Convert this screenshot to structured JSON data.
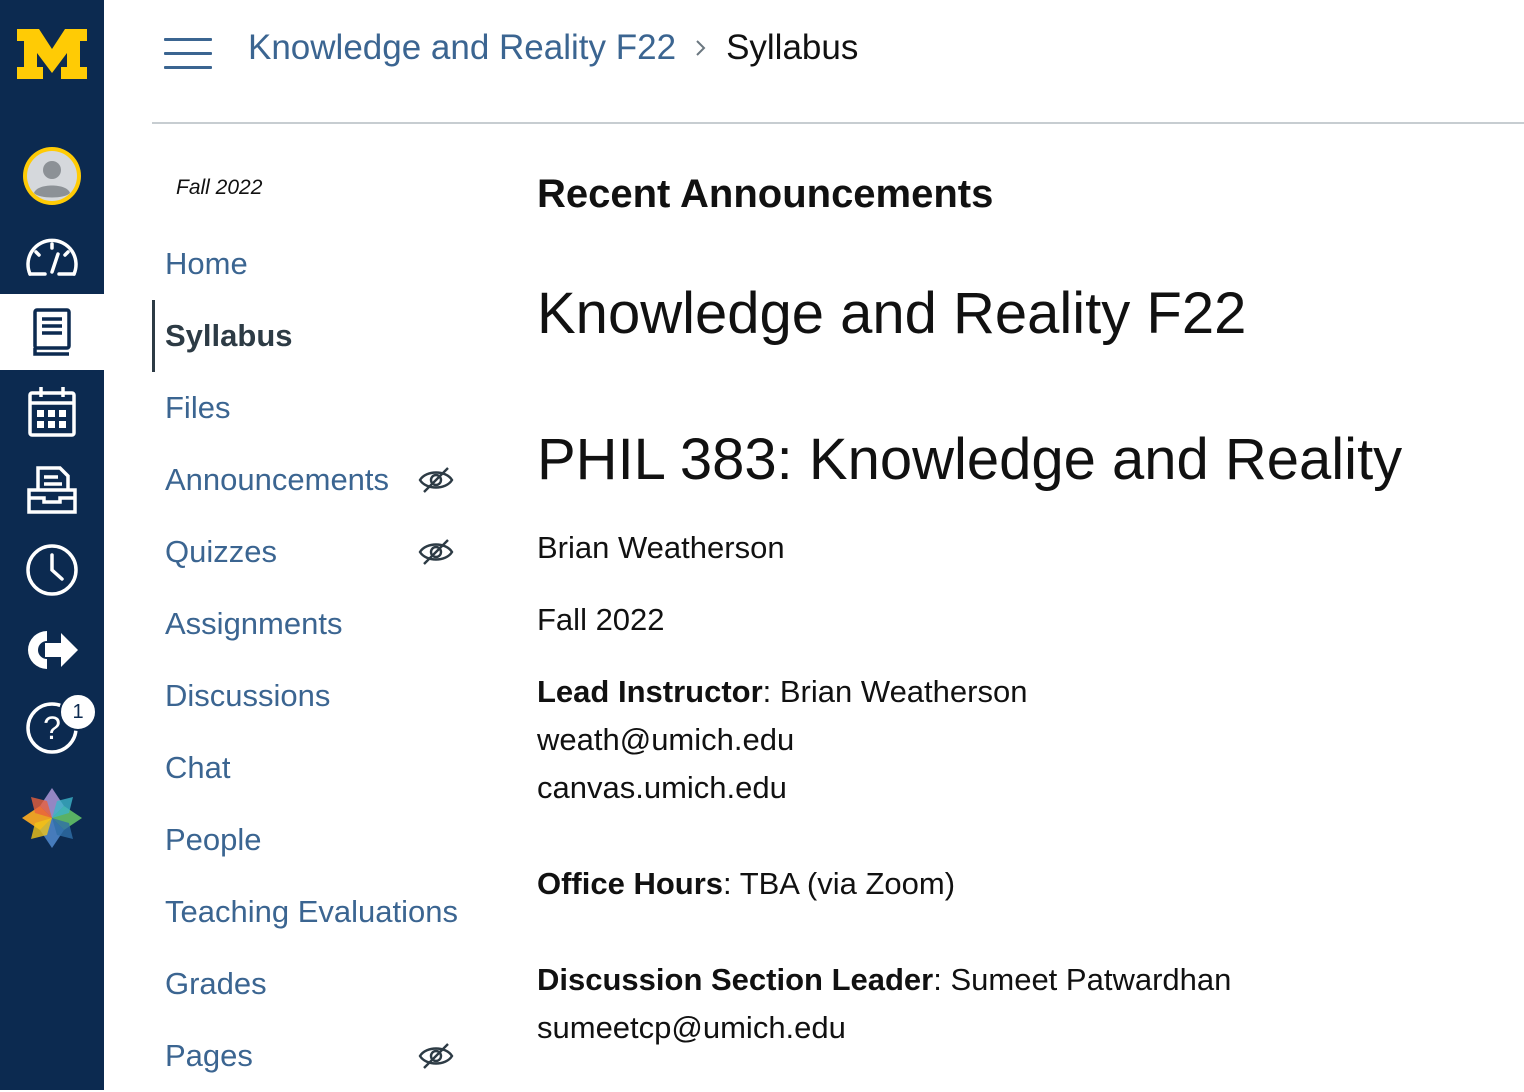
{
  "header": {
    "breadcrumb": {
      "course": "Knowledge and Reality F22",
      "current": "Syllabus"
    }
  },
  "global_nav": {
    "logo_letter": "M",
    "items": [
      {
        "icon": "avatar-icon",
        "label": "Account"
      },
      {
        "icon": "dashboard-icon",
        "label": "Dashboard"
      },
      {
        "icon": "courses-icon",
        "label": "Courses"
      },
      {
        "icon": "calendar-icon",
        "label": "Calendar"
      },
      {
        "icon": "inbox-icon",
        "label": "Inbox"
      },
      {
        "icon": "history-icon",
        "label": "History"
      },
      {
        "icon": "commons-icon",
        "label": "Commons"
      },
      {
        "icon": "help-icon",
        "label": "Help"
      },
      {
        "icon": "app-flower-icon",
        "label": "App"
      }
    ],
    "help_badge": "1",
    "colors": {
      "background": "#0c2a50",
      "maize": "#ffcb05"
    }
  },
  "course_nav": {
    "term": "Fall 2022",
    "items": [
      {
        "label": "Home",
        "hidden": false
      },
      {
        "label": "Syllabus",
        "hidden": false,
        "active": true
      },
      {
        "label": "Files",
        "hidden": false
      },
      {
        "label": "Announcements",
        "hidden": true
      },
      {
        "label": "Quizzes",
        "hidden": true
      },
      {
        "label": "Assignments",
        "hidden": false
      },
      {
        "label": "Discussions",
        "hidden": false
      },
      {
        "label": "Chat",
        "hidden": false
      },
      {
        "label": "People",
        "hidden": false
      },
      {
        "label": "Teaching Evaluations",
        "hidden": false
      },
      {
        "label": "Grades",
        "hidden": false
      },
      {
        "label": "Pages",
        "hidden": true
      }
    ]
  },
  "main": {
    "recent_announcements": "Recent Announcements",
    "course_title": "Knowledge and Reality F22",
    "syllabus_title": "PHIL 383: Knowledge and Reality",
    "instructor_name": "Brian Weatherson",
    "term": "Fall 2022",
    "lead_instructor_label": "Lead Instructor",
    "lead_instructor_value": ": Brian Weatherson",
    "lead_email": "weath@umich.edu",
    "lead_site": "canvas.umich.edu",
    "office_hours_label": "Office Hours",
    "office_hours_value": ": TBA (via Zoom)",
    "section_leader_label": "Discussion Section Leader",
    "section_leader_value": ": Sumeet Patwardhan",
    "section_leader_email": "sumeetcp@umich.edu"
  }
}
